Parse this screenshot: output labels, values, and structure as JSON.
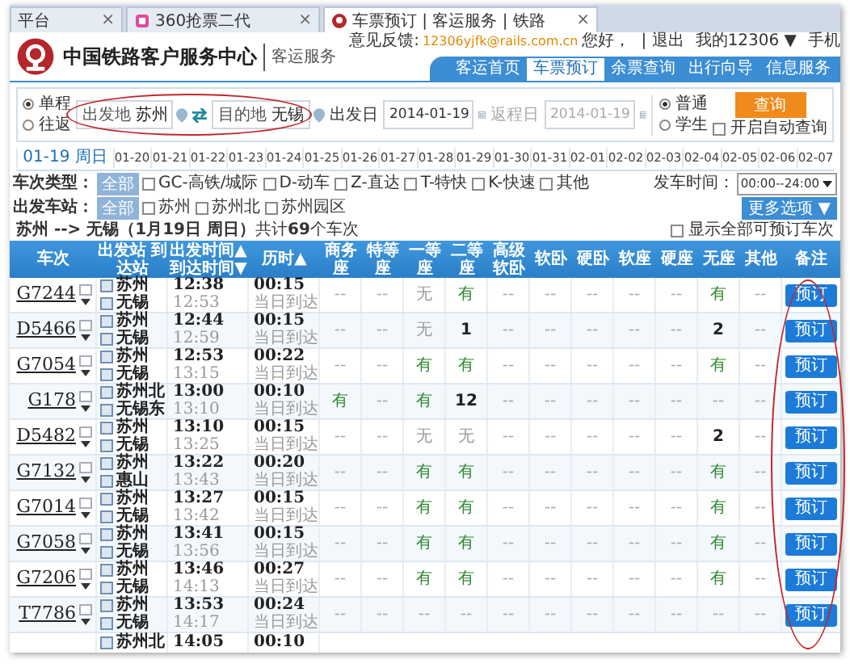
{
  "browser_tabs": [
    {
      "label": "平台",
      "close": "×",
      "selected": false,
      "kind": "plain"
    },
    {
      "label": "360抢票二代",
      "close": "×",
      "selected": false,
      "kind": "app"
    },
    {
      "label": "车票预订 | 客运服务 | 铁路",
      "close": "×",
      "selected": true,
      "kind": "rail"
    }
  ],
  "header": {
    "title": "中国铁路客户服务中心",
    "subtitle": "客运服务",
    "feedback_label": "意见反馈:",
    "feedback_email": "12306yjfk@rails.com.cn",
    "greeting": "您好，",
    "logout": "| 退出",
    "my_account": "我的12306 ▼",
    "phone": "手机"
  },
  "nav": [
    {
      "label": "客运首页",
      "selected": false
    },
    {
      "label": "车票预订",
      "selected": true
    },
    {
      "label": "余票查询",
      "selected": false
    },
    {
      "label": "出行向导",
      "selected": false
    },
    {
      "label": "信息服务",
      "selected": false
    }
  ],
  "search": {
    "trip_types": [
      {
        "label": "单程",
        "selected": true
      },
      {
        "label": "往返",
        "selected": false
      }
    ],
    "from_label": "出发地",
    "from_value": "苏州",
    "to_label": "目的地",
    "to_value": "无锡",
    "circled": true,
    "date_label": "出发日",
    "date_value": "2014-01-19",
    "return_label": "返程日",
    "return_value": "2014-01-19",
    "return_disabled": true,
    "passenger_types": [
      {
        "label": "普通",
        "selected": true
      },
      {
        "label": "学生",
        "selected": false
      }
    ],
    "query_button": "查询",
    "auto_query": {
      "label": "开启自动查询",
      "checked": false
    }
  },
  "dates": [
    {
      "label": "01-19 周日",
      "selected": true
    },
    {
      "label": "01-20",
      "selected": false
    },
    {
      "label": "01-21",
      "selected": false
    },
    {
      "label": "01-22",
      "selected": false
    },
    {
      "label": "01-23",
      "selected": false
    },
    {
      "label": "01-24",
      "selected": false
    },
    {
      "label": "01-25",
      "selected": false
    },
    {
      "label": "01-26",
      "selected": false
    },
    {
      "label": "01-27",
      "selected": false
    },
    {
      "label": "01-28",
      "selected": false
    },
    {
      "label": "01-29",
      "selected": false
    },
    {
      "label": "01-30",
      "selected": false
    },
    {
      "label": "01-31",
      "selected": false
    },
    {
      "label": "02-01",
      "selected": false
    },
    {
      "label": "02-02",
      "selected": false
    },
    {
      "label": "02-03",
      "selected": false
    },
    {
      "label": "02-04",
      "selected": false
    },
    {
      "label": "02-05",
      "selected": false
    },
    {
      "label": "02-06",
      "selected": false
    },
    {
      "label": "02-07",
      "selected": false
    }
  ],
  "filters": {
    "train_type_label": "车次类型：",
    "train_type_all": {
      "label": "全部",
      "selected": true
    },
    "train_types": [
      {
        "label": "GC-高铁/城际",
        "checked": false
      },
      {
        "label": "D-动车",
        "checked": false
      },
      {
        "label": "Z-直达",
        "checked": false
      },
      {
        "label": "T-特快",
        "checked": false
      },
      {
        "label": "K-快速",
        "checked": false
      },
      {
        "label": "其他",
        "checked": false
      }
    ],
    "depart_time_label": "发车时间：",
    "depart_time_value": "00:00--24:00",
    "station_label": "出发车站：",
    "station_all": {
      "label": "全部",
      "selected": true
    },
    "stations": [
      {
        "label": "苏州",
        "checked": false
      },
      {
        "label": "苏州北",
        "checked": false
      },
      {
        "label": "苏州园区",
        "checked": false
      }
    ],
    "more_options": "更多选项 ▼"
  },
  "summary": {
    "text": "**苏州 --> 无锡（1月19日 周日）**共计**69**个车次",
    "show_all": {
      "label": "显示全部可预订车次",
      "checked": false
    }
  },
  "table": {
    "remarks_circled": true,
    "columns": [
      "车次",
      "出发站 到达站",
      "出发时间▲ 到达时间▼",
      "历时▲",
      "商务座",
      "特等座",
      "一等座",
      "二等座",
      "高级软卧",
      "软卧",
      "硬卧",
      "软座",
      "硬座",
      "无座",
      "其他",
      "备注"
    ],
    "rows": [
      {
        "train": "G7244",
        "from": "苏州",
        "to": "无锡",
        "dep": "12:38",
        "arr": "12:53",
        "duration": "00:15",
        "arrival_day": "当日到达",
        "button": "预订",
        "seats": [
          {
            "text": "--",
            "kind": "na"
          },
          {
            "text": "--",
            "kind": "na"
          },
          {
            "text": "无",
            "kind": "none"
          },
          {
            "text": "有",
            "kind": "yes"
          },
          {
            "text": "--",
            "kind": "na"
          },
          {
            "text": "--",
            "kind": "na"
          },
          {
            "text": "--",
            "kind": "na"
          },
          {
            "text": "--",
            "kind": "na"
          },
          {
            "text": "--",
            "kind": "na"
          },
          {
            "text": "有",
            "kind": "yes"
          },
          {
            "text": "--",
            "kind": "na"
          }
        ]
      },
      {
        "train": "D5466",
        "from": "苏州",
        "to": "无锡",
        "dep": "12:44",
        "arr": "12:59",
        "duration": "00:15",
        "arrival_day": "当日到达",
        "button": "预订",
        "seats": [
          {
            "text": "--",
            "kind": "na"
          },
          {
            "text": "--",
            "kind": "na"
          },
          {
            "text": "无",
            "kind": "none"
          },
          {
            "text": "1",
            "kind": "count"
          },
          {
            "text": "--",
            "kind": "na"
          },
          {
            "text": "--",
            "kind": "na"
          },
          {
            "text": "--",
            "kind": "na"
          },
          {
            "text": "--",
            "kind": "na"
          },
          {
            "text": "--",
            "kind": "na"
          },
          {
            "text": "2",
            "kind": "count"
          },
          {
            "text": "--",
            "kind": "na"
          }
        ]
      },
      {
        "train": "G7054",
        "from": "苏州",
        "to": "无锡",
        "dep": "12:53",
        "arr": "13:15",
        "duration": "00:22",
        "arrival_day": "当日到达",
        "button": "预订",
        "seats": [
          {
            "text": "--",
            "kind": "na"
          },
          {
            "text": "--",
            "kind": "na"
          },
          {
            "text": "有",
            "kind": "yes"
          },
          {
            "text": "有",
            "kind": "yes"
          },
          {
            "text": "--",
            "kind": "na"
          },
          {
            "text": "--",
            "kind": "na"
          },
          {
            "text": "--",
            "kind": "na"
          },
          {
            "text": "--",
            "kind": "na"
          },
          {
            "text": "--",
            "kind": "na"
          },
          {
            "text": "有",
            "kind": "yes"
          },
          {
            "text": "--",
            "kind": "na"
          }
        ]
      },
      {
        "train": "G178",
        "from": "苏州北",
        "to": "无锡东",
        "dep": "13:00",
        "arr": "13:10",
        "duration": "00:10",
        "arrival_day": "当日到达",
        "button": "预订",
        "seats": [
          {
            "text": "有",
            "kind": "yes"
          },
          {
            "text": "--",
            "kind": "na"
          },
          {
            "text": "有",
            "kind": "yes"
          },
          {
            "text": "12",
            "kind": "count"
          },
          {
            "text": "--",
            "kind": "na"
          },
          {
            "text": "--",
            "kind": "na"
          },
          {
            "text": "--",
            "kind": "na"
          },
          {
            "text": "--",
            "kind": "na"
          },
          {
            "text": "--",
            "kind": "na"
          },
          {
            "text": "--",
            "kind": "na"
          },
          {
            "text": "--",
            "kind": "na"
          }
        ]
      },
      {
        "train": "D5482",
        "from": "苏州",
        "to": "无锡",
        "dep": "13:10",
        "arr": "13:25",
        "duration": "00:15",
        "arrival_day": "当日到达",
        "button": "预订",
        "seats": [
          {
            "text": "--",
            "kind": "na"
          },
          {
            "text": "--",
            "kind": "na"
          },
          {
            "text": "无",
            "kind": "none"
          },
          {
            "text": "无",
            "kind": "none"
          },
          {
            "text": "--",
            "kind": "na"
          },
          {
            "text": "--",
            "kind": "na"
          },
          {
            "text": "--",
            "kind": "na"
          },
          {
            "text": "--",
            "kind": "na"
          },
          {
            "text": "--",
            "kind": "na"
          },
          {
            "text": "2",
            "kind": "count"
          },
          {
            "text": "--",
            "kind": "na"
          }
        ]
      },
      {
        "train": "G7132",
        "from": "苏州",
        "to": "惠山",
        "dep": "13:22",
        "arr": "13:43",
        "duration": "00:20",
        "arrival_day": "当日到达",
        "button": "预订",
        "seats": [
          {
            "text": "--",
            "kind": "na"
          },
          {
            "text": "--",
            "kind": "na"
          },
          {
            "text": "有",
            "kind": "yes"
          },
          {
            "text": "有",
            "kind": "yes"
          },
          {
            "text": "--",
            "kind": "na"
          },
          {
            "text": "--",
            "kind": "na"
          },
          {
            "text": "--",
            "kind": "na"
          },
          {
            "text": "--",
            "kind": "na"
          },
          {
            "text": "--",
            "kind": "na"
          },
          {
            "text": "有",
            "kind": "yes"
          },
          {
            "text": "--",
            "kind": "na"
          }
        ]
      },
      {
        "train": "G7014",
        "from": "苏州",
        "to": "无锡",
        "dep": "13:27",
        "arr": "13:42",
        "duration": "00:15",
        "arrival_day": "当日到达",
        "button": "预订",
        "seats": [
          {
            "text": "--",
            "kind": "na"
          },
          {
            "text": "--",
            "kind": "na"
          },
          {
            "text": "有",
            "kind": "yes"
          },
          {
            "text": "有",
            "kind": "yes"
          },
          {
            "text": "--",
            "kind": "na"
          },
          {
            "text": "--",
            "kind": "na"
          },
          {
            "text": "--",
            "kind": "na"
          },
          {
            "text": "--",
            "kind": "na"
          },
          {
            "text": "--",
            "kind": "na"
          },
          {
            "text": "有",
            "kind": "yes"
          },
          {
            "text": "--",
            "kind": "na"
          }
        ]
      },
      {
        "train": "G7058",
        "from": "苏州",
        "to": "无锡",
        "dep": "13:41",
        "arr": "13:56",
        "duration": "00:15",
        "arrival_day": "当日到达",
        "button": "预订",
        "seats": [
          {
            "text": "--",
            "kind": "na"
          },
          {
            "text": "--",
            "kind": "na"
          },
          {
            "text": "有",
            "kind": "yes"
          },
          {
            "text": "有",
            "kind": "yes"
          },
          {
            "text": "--",
            "kind": "na"
          },
          {
            "text": "--",
            "kind": "na"
          },
          {
            "text": "--",
            "kind": "na"
          },
          {
            "text": "--",
            "kind": "na"
          },
          {
            "text": "--",
            "kind": "na"
          },
          {
            "text": "有",
            "kind": "yes"
          },
          {
            "text": "--",
            "kind": "na"
          }
        ]
      },
      {
        "train": "G7206",
        "from": "苏州",
        "to": "无锡",
        "dep": "13:46",
        "arr": "14:13",
        "duration": "00:27",
        "arrival_day": "当日到达",
        "button": "预订",
        "seats": [
          {
            "text": "--",
            "kind": "na"
          },
          {
            "text": "--",
            "kind": "na"
          },
          {
            "text": "有",
            "kind": "yes"
          },
          {
            "text": "有",
            "kind": "yes"
          },
          {
            "text": "--",
            "kind": "na"
          },
          {
            "text": "--",
            "kind": "na"
          },
          {
            "text": "--",
            "kind": "na"
          },
          {
            "text": "--",
            "kind": "na"
          },
          {
            "text": "--",
            "kind": "na"
          },
          {
            "text": "有",
            "kind": "yes"
          },
          {
            "text": "--",
            "kind": "na"
          }
        ]
      },
      {
        "train": "T7786",
        "from": "苏州",
        "to": "无锡",
        "dep": "13:53",
        "arr": "14:17",
        "duration": "00:24",
        "arrival_day": "当日到达",
        "button": "预订",
        "seats": [
          {
            "text": "--",
            "kind": "na"
          },
          {
            "text": "--",
            "kind": "na"
          },
          {
            "text": "--",
            "kind": "na"
          },
          {
            "text": "--",
            "kind": "na"
          },
          {
            "text": "--",
            "kind": "na"
          },
          {
            "text": "--",
            "kind": "na"
          },
          {
            "text": "--",
            "kind": "na"
          },
          {
            "text": "--",
            "kind": "na"
          },
          {
            "text": "--",
            "kind": "na"
          },
          {
            "text": "--",
            "kind": "na"
          },
          {
            "text": "--",
            "kind": "na"
          }
        ]
      }
    ],
    "partial_row": {
      "from": "苏州北",
      "dep": "14:05",
      "duration": "00:10"
    }
  }
}
